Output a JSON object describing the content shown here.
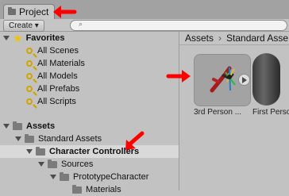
{
  "window": {
    "tab_label": "Project"
  },
  "toolbar": {
    "create_label": "Create ▾",
    "search_placeholder": ""
  },
  "sidebar": {
    "favorites_label": "Favorites",
    "favorites_items": [
      "All Scenes",
      "All Materials",
      "All Models",
      "All Prefabs",
      "All Scripts"
    ],
    "assets_label": "Assets",
    "tree": {
      "standard_assets": "Standard Assets",
      "character_controllers": "Character Controllers",
      "sources": "Sources",
      "prototype_character": "PrototypeCharacter",
      "materials": "Materials"
    }
  },
  "main": {
    "breadcrumb": [
      "Assets",
      "Standard Asse"
    ],
    "items": [
      {
        "label": "3rd Person ...",
        "icon": "character-prefab-icon"
      },
      {
        "label": "First Perso",
        "icon": "capsule-prefab-icon"
      }
    ]
  },
  "colors": {
    "accent": "#ff0000",
    "selection": "#d9d9d9",
    "panel": "#c2c2c2"
  }
}
